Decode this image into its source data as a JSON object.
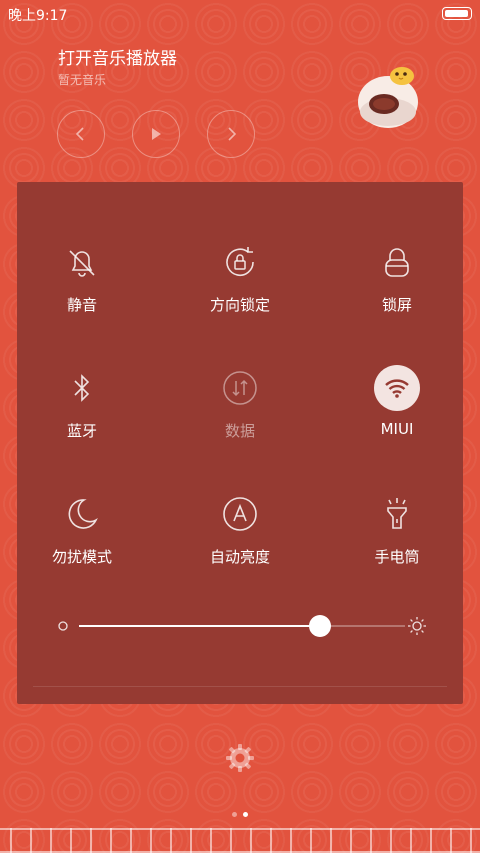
{
  "status_bar": {
    "time": "晚上9:17",
    "battery_level": 0.95
  },
  "music": {
    "title": "打开音乐播放器",
    "subtitle": "暂无音乐",
    "controls": [
      "previous-icon",
      "play-icon",
      "next-icon"
    ]
  },
  "toggles": [
    {
      "label": "静音",
      "icon": "mute-bell-icon",
      "active": false
    },
    {
      "label": "方向锁定",
      "icon": "rotation-lock-icon",
      "active": false
    },
    {
      "label": "锁屏",
      "icon": "lock-icon",
      "active": false
    },
    {
      "label": "蓝牙",
      "icon": "bluetooth-icon",
      "active": false
    },
    {
      "label": "数据",
      "icon": "data-icon",
      "active": false,
      "disabled": true
    },
    {
      "label": "MIUI",
      "icon": "wifi-icon",
      "active": true
    },
    {
      "label": "勿扰模式",
      "icon": "moon-icon",
      "active": false
    },
    {
      "label": "自动亮度",
      "icon": "auto-brightness-icon",
      "active": false
    },
    {
      "label": "手电筒",
      "icon": "flashlight-icon",
      "active": false
    }
  ],
  "brightness": {
    "value": 0.74
  },
  "pager": {
    "count": 2,
    "active": 1
  },
  "colors": {
    "background": "#e2533e",
    "panel": "#963a32",
    "accent": "#ffffff"
  }
}
